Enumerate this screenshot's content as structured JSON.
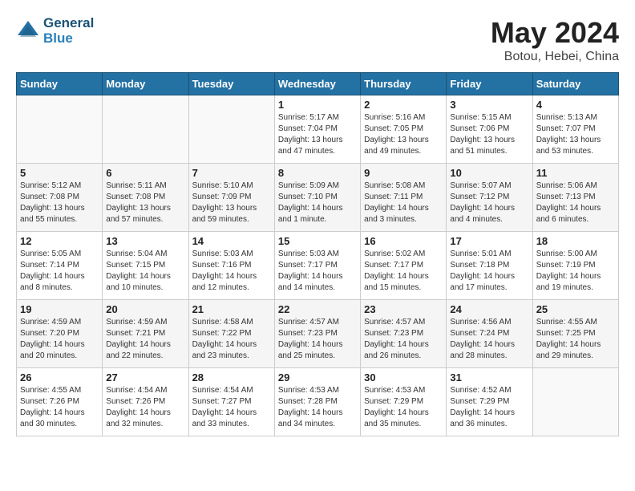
{
  "header": {
    "logo_line1": "General",
    "logo_line2": "Blue",
    "month": "May 2024",
    "location": "Botou, Hebei, China"
  },
  "weekdays": [
    "Sunday",
    "Monday",
    "Tuesday",
    "Wednesday",
    "Thursday",
    "Friday",
    "Saturday"
  ],
  "weeks": [
    [
      {
        "day": "",
        "info": ""
      },
      {
        "day": "",
        "info": ""
      },
      {
        "day": "",
        "info": ""
      },
      {
        "day": "1",
        "info": "Sunrise: 5:17 AM\nSunset: 7:04 PM\nDaylight: 13 hours\nand 47 minutes."
      },
      {
        "day": "2",
        "info": "Sunrise: 5:16 AM\nSunset: 7:05 PM\nDaylight: 13 hours\nand 49 minutes."
      },
      {
        "day": "3",
        "info": "Sunrise: 5:15 AM\nSunset: 7:06 PM\nDaylight: 13 hours\nand 51 minutes."
      },
      {
        "day": "4",
        "info": "Sunrise: 5:13 AM\nSunset: 7:07 PM\nDaylight: 13 hours\nand 53 minutes."
      }
    ],
    [
      {
        "day": "5",
        "info": "Sunrise: 5:12 AM\nSunset: 7:08 PM\nDaylight: 13 hours\nand 55 minutes."
      },
      {
        "day": "6",
        "info": "Sunrise: 5:11 AM\nSunset: 7:08 PM\nDaylight: 13 hours\nand 57 minutes."
      },
      {
        "day": "7",
        "info": "Sunrise: 5:10 AM\nSunset: 7:09 PM\nDaylight: 13 hours\nand 59 minutes."
      },
      {
        "day": "8",
        "info": "Sunrise: 5:09 AM\nSunset: 7:10 PM\nDaylight: 14 hours\nand 1 minute."
      },
      {
        "day": "9",
        "info": "Sunrise: 5:08 AM\nSunset: 7:11 PM\nDaylight: 14 hours\nand 3 minutes."
      },
      {
        "day": "10",
        "info": "Sunrise: 5:07 AM\nSunset: 7:12 PM\nDaylight: 14 hours\nand 4 minutes."
      },
      {
        "day": "11",
        "info": "Sunrise: 5:06 AM\nSunset: 7:13 PM\nDaylight: 14 hours\nand 6 minutes."
      }
    ],
    [
      {
        "day": "12",
        "info": "Sunrise: 5:05 AM\nSunset: 7:14 PM\nDaylight: 14 hours\nand 8 minutes."
      },
      {
        "day": "13",
        "info": "Sunrise: 5:04 AM\nSunset: 7:15 PM\nDaylight: 14 hours\nand 10 minutes."
      },
      {
        "day": "14",
        "info": "Sunrise: 5:03 AM\nSunset: 7:16 PM\nDaylight: 14 hours\nand 12 minutes."
      },
      {
        "day": "15",
        "info": "Sunrise: 5:03 AM\nSunset: 7:17 PM\nDaylight: 14 hours\nand 14 minutes."
      },
      {
        "day": "16",
        "info": "Sunrise: 5:02 AM\nSunset: 7:17 PM\nDaylight: 14 hours\nand 15 minutes."
      },
      {
        "day": "17",
        "info": "Sunrise: 5:01 AM\nSunset: 7:18 PM\nDaylight: 14 hours\nand 17 minutes."
      },
      {
        "day": "18",
        "info": "Sunrise: 5:00 AM\nSunset: 7:19 PM\nDaylight: 14 hours\nand 19 minutes."
      }
    ],
    [
      {
        "day": "19",
        "info": "Sunrise: 4:59 AM\nSunset: 7:20 PM\nDaylight: 14 hours\nand 20 minutes."
      },
      {
        "day": "20",
        "info": "Sunrise: 4:59 AM\nSunset: 7:21 PM\nDaylight: 14 hours\nand 22 minutes."
      },
      {
        "day": "21",
        "info": "Sunrise: 4:58 AM\nSunset: 7:22 PM\nDaylight: 14 hours\nand 23 minutes."
      },
      {
        "day": "22",
        "info": "Sunrise: 4:57 AM\nSunset: 7:23 PM\nDaylight: 14 hours\nand 25 minutes."
      },
      {
        "day": "23",
        "info": "Sunrise: 4:57 AM\nSunset: 7:23 PM\nDaylight: 14 hours\nand 26 minutes."
      },
      {
        "day": "24",
        "info": "Sunrise: 4:56 AM\nSunset: 7:24 PM\nDaylight: 14 hours\nand 28 minutes."
      },
      {
        "day": "25",
        "info": "Sunrise: 4:55 AM\nSunset: 7:25 PM\nDaylight: 14 hours\nand 29 minutes."
      }
    ],
    [
      {
        "day": "26",
        "info": "Sunrise: 4:55 AM\nSunset: 7:26 PM\nDaylight: 14 hours\nand 30 minutes."
      },
      {
        "day": "27",
        "info": "Sunrise: 4:54 AM\nSunset: 7:26 PM\nDaylight: 14 hours\nand 32 minutes."
      },
      {
        "day": "28",
        "info": "Sunrise: 4:54 AM\nSunset: 7:27 PM\nDaylight: 14 hours\nand 33 minutes."
      },
      {
        "day": "29",
        "info": "Sunrise: 4:53 AM\nSunset: 7:28 PM\nDaylight: 14 hours\nand 34 minutes."
      },
      {
        "day": "30",
        "info": "Sunrise: 4:53 AM\nSunset: 7:29 PM\nDaylight: 14 hours\nand 35 minutes."
      },
      {
        "day": "31",
        "info": "Sunrise: 4:52 AM\nSunset: 7:29 PM\nDaylight: 14 hours\nand 36 minutes."
      },
      {
        "day": "",
        "info": ""
      }
    ]
  ]
}
